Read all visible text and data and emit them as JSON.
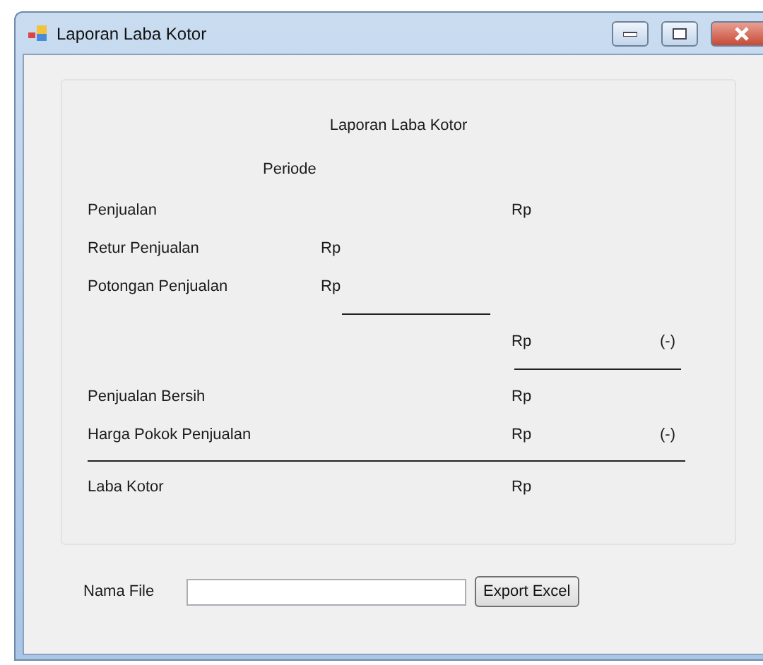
{
  "window": {
    "title": "Laporan Laba Kotor"
  },
  "report": {
    "title": "Laporan Laba Kotor",
    "period_label": "Periode",
    "lines": [
      {
        "kind": "item",
        "label": "Penjualan",
        "amount_right": "Rp"
      },
      {
        "kind": "item",
        "label": "Retur Penjualan",
        "amount_left": "Rp"
      },
      {
        "kind": "item",
        "label": "Potongan Penjualan",
        "amount_left": "Rp"
      },
      {
        "kind": "subtotal_rule"
      },
      {
        "kind": "item",
        "amount_right": "Rp",
        "note": "(-)"
      },
      {
        "kind": "difference_rule"
      },
      {
        "kind": "item",
        "label": "Penjualan Bersih",
        "amount_right": "Rp"
      },
      {
        "kind": "item",
        "label": "Harga Pokok Penjualan",
        "amount_right": "Rp",
        "note": "(-)"
      },
      {
        "kind": "total_rule"
      },
      {
        "kind": "item",
        "label": "Laba Kotor",
        "amount_right": "Rp"
      }
    ]
  },
  "export": {
    "label": "Nama File",
    "button": "Export Excel"
  }
}
